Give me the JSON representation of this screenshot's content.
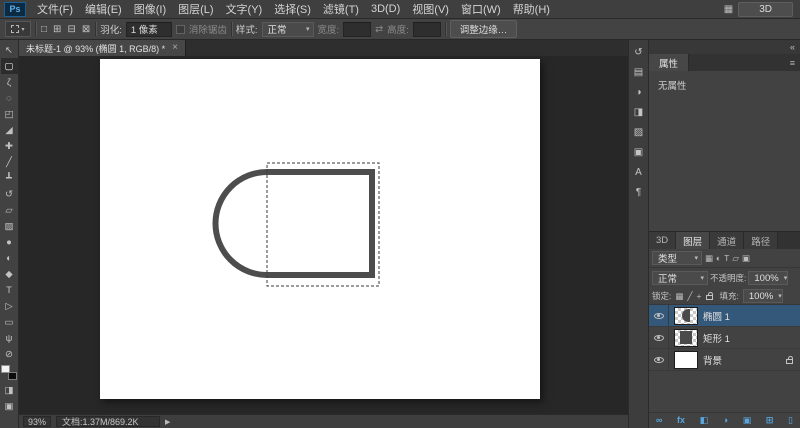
{
  "menubar": {
    "logo": "Ps",
    "items": [
      "文件(F)",
      "编辑(E)",
      "图像(I)",
      "图层(L)",
      "文字(Y)",
      "选择(S)",
      "滤镜(T)",
      "3D(D)",
      "视图(V)",
      "窗口(W)",
      "帮助(H)"
    ],
    "workspace_grid_icon": "▦",
    "workspace_button": "3D"
  },
  "options": {
    "selection_mode_icons": [
      "□",
      "⊞",
      "⊟",
      "⊠"
    ],
    "feather_label": "羽化:",
    "feather_value": "1 像素",
    "antialias_label": "消除锯齿",
    "style_label": "样式:",
    "style_value": "正常",
    "width_label": "宽度:",
    "width_value": "",
    "swap_icon": "⇄",
    "height_label": "高度:",
    "height_value": "",
    "refine_edge_button": "调整边缘…"
  },
  "document": {
    "tab_title": "未标题-1 @ 93% (椭圆 1, RGB/8) *",
    "close_icon": "×"
  },
  "toolbar": {
    "tools": [
      {
        "name": "move-tool",
        "glyph": "↖"
      },
      {
        "name": "rectangular-marquee-tool",
        "glyph": "▢"
      },
      {
        "name": "lasso-tool",
        "glyph": "ζ"
      },
      {
        "name": "quick-selection-tool",
        "glyph": "◌"
      },
      {
        "name": "crop-tool",
        "glyph": "◰"
      },
      {
        "name": "eyedropper-tool",
        "glyph": "◢"
      },
      {
        "name": "healing-brush-tool",
        "glyph": "✚"
      },
      {
        "name": "brush-tool",
        "glyph": "╱"
      },
      {
        "name": "clone-stamp-tool",
        "glyph": "┻"
      },
      {
        "name": "history-brush-tool",
        "glyph": "↺"
      },
      {
        "name": "eraser-tool",
        "glyph": "▱"
      },
      {
        "name": "gradient-tool",
        "glyph": "▨"
      },
      {
        "name": "blur-tool",
        "glyph": "●"
      },
      {
        "name": "dodge-tool",
        "glyph": "◐"
      },
      {
        "name": "pen-tool",
        "glyph": "◆"
      },
      {
        "name": "type-tool",
        "glyph": "T"
      },
      {
        "name": "path-selection-tool",
        "glyph": "▷"
      },
      {
        "name": "shape-tool",
        "glyph": "▭"
      },
      {
        "name": "hand-tool",
        "glyph": "ψ"
      },
      {
        "name": "zoom-tool",
        "glyph": "⊘"
      }
    ],
    "quick_mask_icon": "◨",
    "screen_mode_icon": "▣"
  },
  "dock": {
    "collapse_icon": "«",
    "icons": [
      {
        "name": "history-panel-icon",
        "glyph": "↺"
      },
      {
        "name": "swatches-panel-icon",
        "glyph": "▤"
      },
      {
        "name": "adjustments-panel-icon",
        "glyph": "◑"
      },
      {
        "name": "styles-panel-icon",
        "glyph": "◨"
      },
      {
        "name": "brush-panel-icon",
        "glyph": "▨"
      },
      {
        "name": "clone-source-panel-icon",
        "glyph": "▣"
      },
      {
        "name": "character-panel-icon",
        "glyph": "A"
      },
      {
        "name": "paragraph-panel-icon",
        "glyph": "¶"
      }
    ]
  },
  "properties": {
    "tab": "属性",
    "menu_icon": "≡",
    "empty_text": "无属性"
  },
  "layers": {
    "tabs": [
      "3D",
      "图层",
      "通道",
      "路径"
    ],
    "filter_label": "类型",
    "filter_icons": [
      "▦",
      "◐",
      "T",
      "▱",
      "▣"
    ],
    "blend_mode": "正常",
    "opacity_label": "不透明度:",
    "opacity_value": "100%",
    "lock_label": "锁定:",
    "lock_icons": [
      "▦",
      "╱",
      "+"
    ],
    "fill_label": "填充:",
    "fill_value": "100%",
    "items": [
      {
        "name": "椭圆 1"
      },
      {
        "name": "矩形 1"
      },
      {
        "name": "背景"
      }
    ],
    "bottom_icons": [
      {
        "name": "link-layers-icon",
        "glyph": "∞"
      },
      {
        "name": "layer-effects-icon",
        "glyph": "fx"
      },
      {
        "name": "layer-mask-icon",
        "glyph": "◧"
      },
      {
        "name": "adjustment-layer-icon",
        "glyph": "◑"
      },
      {
        "name": "layer-group-icon",
        "glyph": "▣"
      },
      {
        "name": "new-layer-icon",
        "glyph": "⊞"
      },
      {
        "name": "delete-layer-icon",
        "glyph": "▯"
      }
    ]
  },
  "status": {
    "zoom": "93%",
    "doc_info": "文档:1.37M/869.2K",
    "arrow_icon": "▶"
  }
}
